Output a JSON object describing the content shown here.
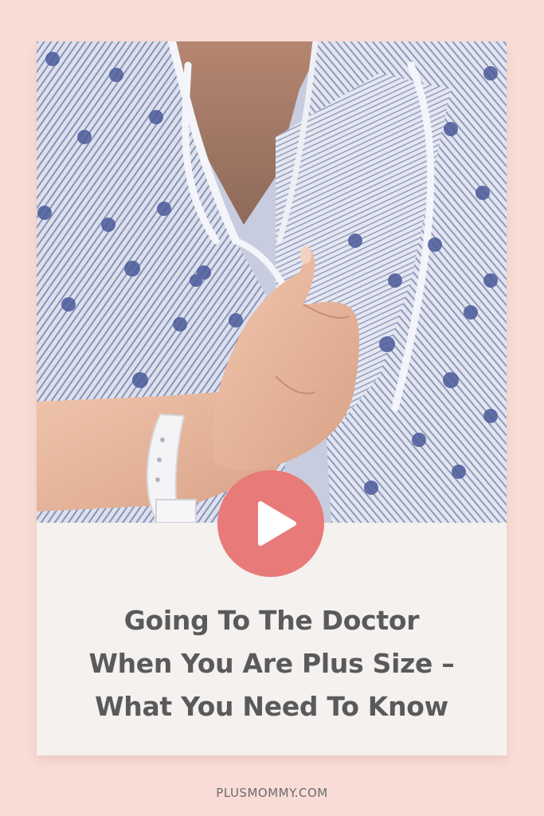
{
  "photo": {
    "icon": "hospital-gown-photo",
    "colors": {
      "gown_stripes": "#8a93b6",
      "gown_base": "#d6dbea",
      "medallion": "#4b5a9a",
      "skin": "#e9b9a0",
      "wristband": "#f4f4f6"
    }
  },
  "play": {
    "icon": "play-icon",
    "color": "#e97a7a"
  },
  "title": {
    "lines": [
      "Going To The Doctor",
      "When You Are Plus Size –",
      "What You Need To Know"
    ]
  },
  "footer": {
    "site": "PLUSMOMMY.COM"
  },
  "colors": {
    "page_background": "#f9dcd5",
    "card_background": "#f4f1ee",
    "title_text": "#5a5a5d"
  }
}
